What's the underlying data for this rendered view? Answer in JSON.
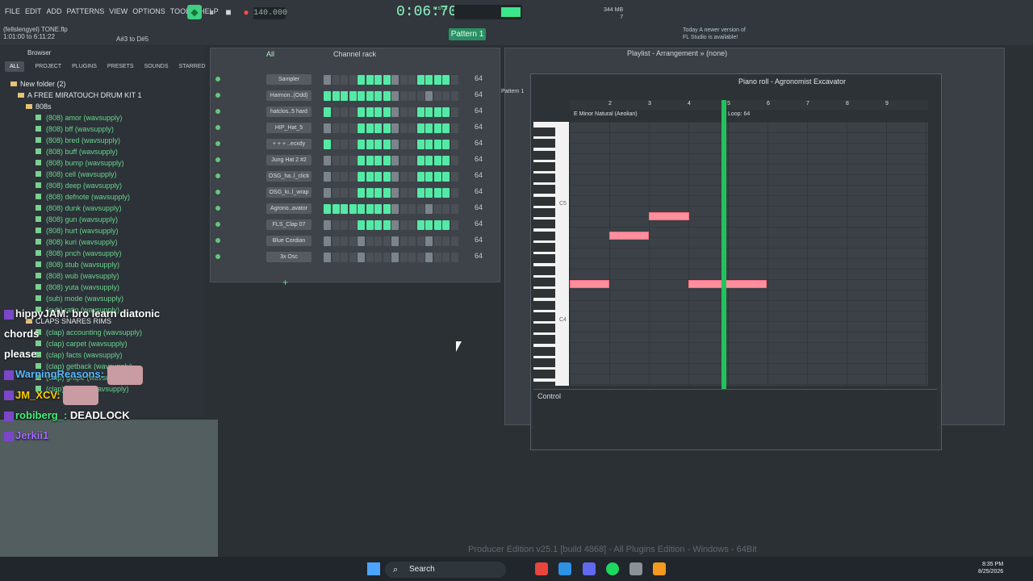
{
  "menu": [
    "FILE",
    "EDIT",
    "ADD",
    "PATTERNS",
    "VIEW",
    "OPTIONS",
    "TOOLS",
    "HELP"
  ],
  "song": {
    "file": "(fellslengyel) TONE.flp",
    "time": "1:01:00 to 6:11:22",
    "note_hint": "A#3 to D#5"
  },
  "tempo": "140.000",
  "clock": "0:06:70",
  "clock_unit": "M:S:CS",
  "pattern": "Pattern 1",
  "cpu": {
    "memory": "344 MB",
    "voices": "7"
  },
  "update": {
    "line1": "Today  A newer version of",
    "line2": "FL Studio is available!"
  },
  "browser": {
    "label": "Browser",
    "tabs": [
      "ALL",
      "PROJECT",
      "PLUGINS",
      "PRESETS",
      "SOUNDS",
      "STARRED"
    ],
    "items": [
      "New folder (2)",
      "A FREE MIRATOUCH DRUM KIT 1",
      "808s",
      "(808) amor (wavsupply)",
      "(808) bff (wavsupply)",
      "(808) bred (wavsupply)",
      "(808) buff (wavsupply)",
      "(808) bump (wavsupply)",
      "(808) cell (wavsupply)",
      "(808) deep (wavsupply)",
      "(808) defnote (wavsupply)",
      "(808) dunk (wavsupply)",
      "(808) gun (wavsupply)",
      "(808) hurt (wavsupply)",
      "(808) kuri (wavsupply)",
      "(808) pnch (wavsupply)",
      "(808) stub (wavsupply)",
      "(808) wub (wavsupply)",
      "(808) yuta (wavsupply)",
      "(sub) mode (wavsupply)",
      "(sub) ratio (wavsupply)",
      "CLAPS SNARES RIMS",
      "(clap) accounting (wavsupply)",
      "(clap) carpet (wavsupply)",
      "(clap) facts (wavsupply)",
      "(clap) getback (wavsupply)",
      "(clap) grape (wavsupply)",
      "(clap) money (wavsupply)"
    ]
  },
  "channel_rack": {
    "title": "Channel rack",
    "filter": "All",
    "channels": [
      "Sampler",
      "Harmon..(Odd)",
      "hatclos..5 hard",
      "HIP_Hat_5",
      "+ + + ..ecxdy",
      "Jung Hat 2 #2",
      "OSG_ha..l_click",
      "OSG_ki..l_wrap",
      "Agrono..avator",
      "FLS_Clap 07",
      "Blue Cordian",
      "3x Osc"
    ],
    "steps": "64"
  },
  "playlist": {
    "title": "Playlist - Arrangement",
    "arrangement": "(none)",
    "pattern": "Pattern 1"
  },
  "piano_roll": {
    "title": "Piano roll - Agronomist Excavator",
    "scale": "E Minor Natural (Aeolian)",
    "loop": "Loop: 64",
    "control": "Control",
    "key_labels": [
      "C5",
      "C4"
    ],
    "ruler": [
      "2",
      "3",
      "4",
      "5",
      "6",
      "7",
      "8",
      "9"
    ]
  },
  "chat": [
    {
      "user": "hippyJAM:",
      "msg": "bro learn diatonic chords",
      "cont": "please"
    },
    {
      "user": "WarningReasons:"
    },
    {
      "user": "JM_XCV:"
    },
    {
      "user": "robiberg_:",
      "msg": "DEADLOCK"
    },
    {
      "user": "Jerkii1"
    }
  ],
  "taskbar": {
    "search": "Search",
    "time": "8:35 PM",
    "date": "8/25/2026"
  },
  "footer": "Producer Edition v25.1 [build 4868] - All Plugins Edition - Windows - 64Bit",
  "colors": {
    "accent": "#55e9a6",
    "note": "#ff8f9d",
    "playhead": "#22c35d"
  }
}
